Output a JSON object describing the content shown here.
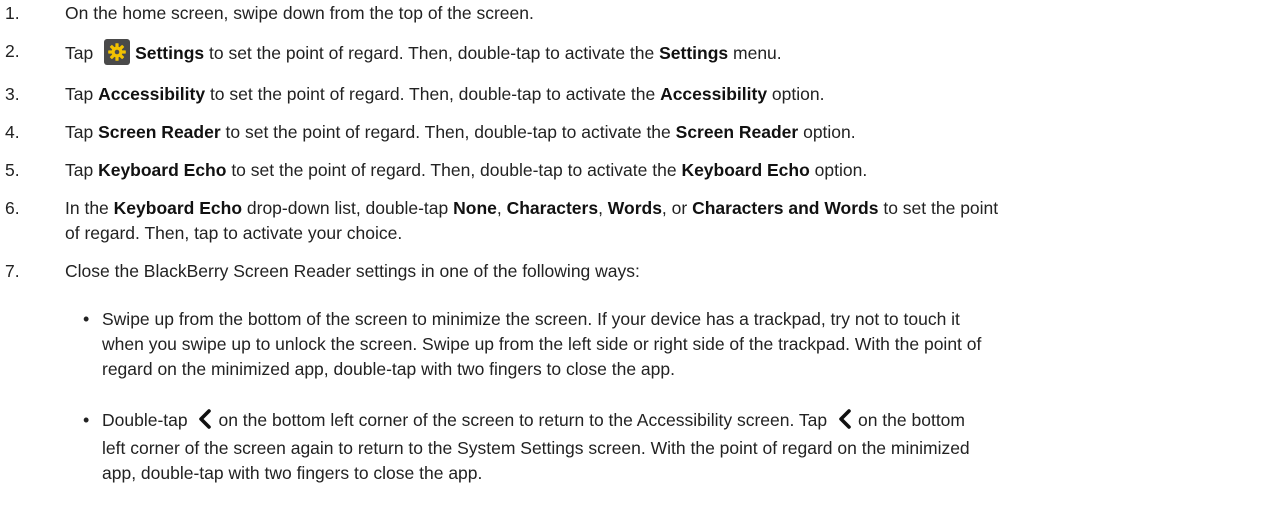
{
  "steps": [
    {
      "num": "1.",
      "parts": [
        {
          "t": "On the home screen, swipe down from the top of the screen."
        }
      ]
    },
    {
      "num": "2.",
      "parts": [
        {
          "t": "Tap "
        },
        {
          "icon": "settings-gear-icon"
        },
        {
          "t": "Settings",
          "b": true
        },
        {
          "t": " to set the point of regard. Then, double-tap to activate the "
        },
        {
          "t": "Settings",
          "b": true
        },
        {
          "t": " menu."
        }
      ]
    },
    {
      "num": "3.",
      "parts": [
        {
          "t": "Tap "
        },
        {
          "t": "Accessibility",
          "b": true
        },
        {
          "t": " to set the point of regard. Then, double-tap to activate the "
        },
        {
          "t": "Accessibility",
          "b": true
        },
        {
          "t": " option."
        }
      ]
    },
    {
      "num": "4.",
      "parts": [
        {
          "t": "Tap "
        },
        {
          "t": "Screen Reader",
          "b": true
        },
        {
          "t": " to set the point of regard. Then, double-tap to activate the "
        },
        {
          "t": "Screen Reader",
          "b": true
        },
        {
          "t": " option."
        }
      ]
    },
    {
      "num": "5.",
      "parts": [
        {
          "t": "Tap "
        },
        {
          "t": "Keyboard Echo",
          "b": true
        },
        {
          "t": " to set the point of regard. Then, double-tap to activate the "
        },
        {
          "t": "Keyboard Echo",
          "b": true
        },
        {
          "t": " option."
        }
      ]
    },
    {
      "num": "6.",
      "parts": [
        {
          "t": "In the "
        },
        {
          "t": "Keyboard Echo",
          "b": true
        },
        {
          "t": " drop-down list, double-tap "
        },
        {
          "t": "None",
          "b": true
        },
        {
          "t": ", "
        },
        {
          "t": "Characters",
          "b": true
        },
        {
          "t": ", "
        },
        {
          "t": "Words",
          "b": true
        },
        {
          "t": ", or "
        },
        {
          "t": "Characters and Words",
          "b": true
        },
        {
          "t": " to set the point"
        },
        {
          "br": true
        },
        {
          "t": "of regard. Then, tap to activate your choice."
        }
      ]
    },
    {
      "num": "7.",
      "parts": [
        {
          "t": "Close the BlackBerry Screen Reader settings in one of the following ways:"
        }
      ]
    }
  ],
  "bullets": [
    {
      "parts": [
        {
          "t": "Swipe up from the bottom of the screen to minimize the screen. If your device has a trackpad, try not to touch it"
        },
        {
          "br": true
        },
        {
          "t": "when you swipe up to unlock the screen. Swipe up from the left side or right side of the trackpad. With the point of"
        },
        {
          "br": true
        },
        {
          "t": "regard on the minimized app, double-tap with two fingers to close the app."
        }
      ]
    },
    {
      "parts": [
        {
          "t": "Double-tap "
        },
        {
          "icon": "back-chevron-icon"
        },
        {
          "t": "on the bottom left corner of the screen to return to the Accessibility screen. Tap "
        },
        {
          "icon": "back-chevron-icon"
        },
        {
          "t": "on the bottom"
        },
        {
          "br": true
        },
        {
          "t": "left corner of the screen again to return to the System Settings screen. With the point of regard on the minimized"
        },
        {
          "br": true
        },
        {
          "t": "app, double-tap with two fingers to close the app."
        }
      ]
    }
  ],
  "bullet_char": "•"
}
